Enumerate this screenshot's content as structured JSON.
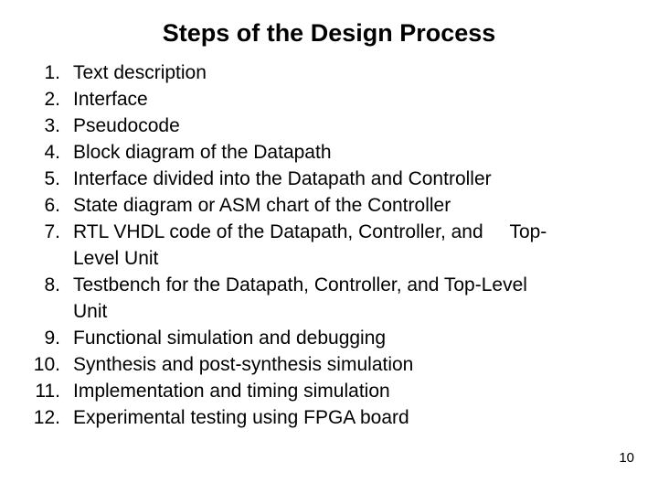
{
  "slide": {
    "title": "Steps of the Design Process",
    "page_number": "10",
    "background_color": "#ffffff",
    "text_color": "#000000"
  },
  "list": {
    "items": [
      {
        "number": "1.",
        "lines": [
          "Text description"
        ]
      },
      {
        "number": "2.",
        "lines": [
          "Interface"
        ]
      },
      {
        "number": "3.",
        "lines": [
          "Pseudocode"
        ]
      },
      {
        "number": "4.",
        "lines": [
          "Block diagram of the Datapath"
        ]
      },
      {
        "number": "5.",
        "lines": [
          "Interface divided into the Datapath and Controller"
        ]
      },
      {
        "number": "6.",
        "lines": [
          "State diagram or ASM chart of the Controller"
        ]
      },
      {
        "number": "7.",
        "lines": [
          "RTL VHDL code of the Datapath, Controller, and     Top-",
          "Level Unit"
        ]
      },
      {
        "number": "8.",
        "lines": [
          "Testbench for the Datapath, Controller, and Top-Level",
          "Unit"
        ]
      },
      {
        "number": "9.",
        "lines": [
          "Functional simulation and debugging"
        ]
      },
      {
        "number": "10.",
        "lines": [
          "Synthesis and post-synthesis simulation"
        ]
      },
      {
        "number": "11.",
        "lines": [
          "Implementation and timing simulation"
        ]
      },
      {
        "number": "12.",
        "lines": [
          "Experimental testing using FPGA board"
        ]
      }
    ]
  }
}
